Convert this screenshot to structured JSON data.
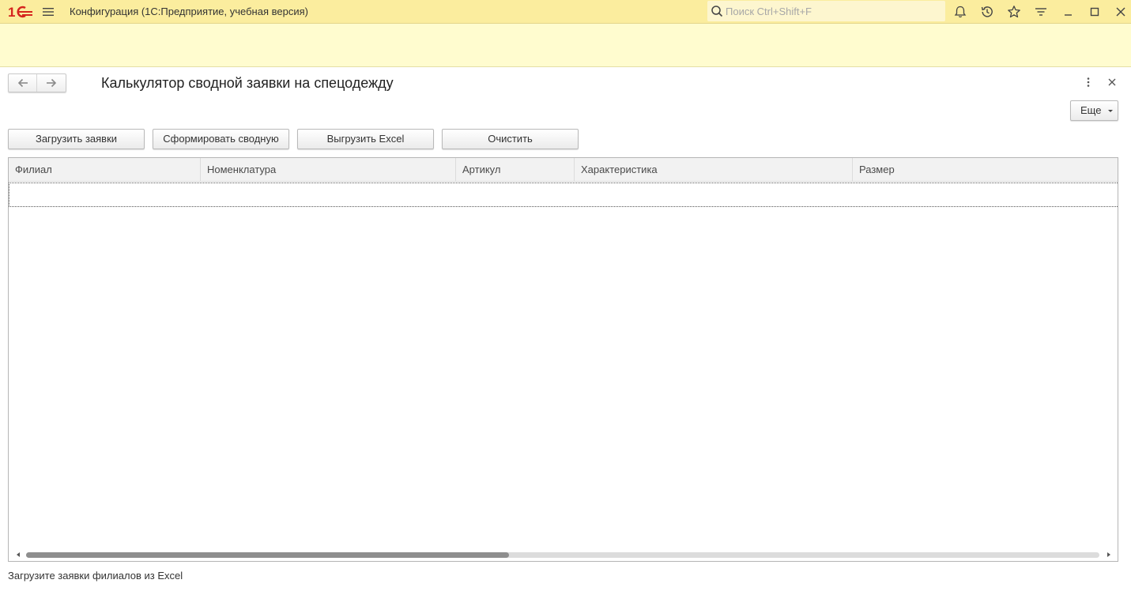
{
  "titlebar": {
    "logo_text": "1C",
    "app_title": "Конфигурация  (1С:Предприятие, учебная версия)",
    "search_placeholder": "Поиск Ctrl+Shift+F",
    "icons": [
      "bell-icon",
      "history-icon",
      "star-icon",
      "funnel-icon",
      "minimize-icon",
      "maximize-icon",
      "close-icon"
    ]
  },
  "form": {
    "title": "Калькулятор сводной заявки на спецодежду",
    "more_button": "Еще",
    "buttons": {
      "load": "Загрузить заявки",
      "build": "Сформировать сводную",
      "export": "Выгрузить Excel",
      "clear": "Очистить"
    }
  },
  "table": {
    "columns": [
      "Филиал",
      "Номенклатура",
      "Артикул",
      "Характеристика",
      "Размер"
    ],
    "rows": [],
    "scroll_position": 0,
    "scroll_visible_fraction": 0.45
  },
  "status_text": "Загрузите заявки филиалов из Excel",
  "colors": {
    "titlebar_bg": "#fbed9e",
    "infoband_bg": "#fffccf",
    "logo_red": "#d5251e"
  }
}
